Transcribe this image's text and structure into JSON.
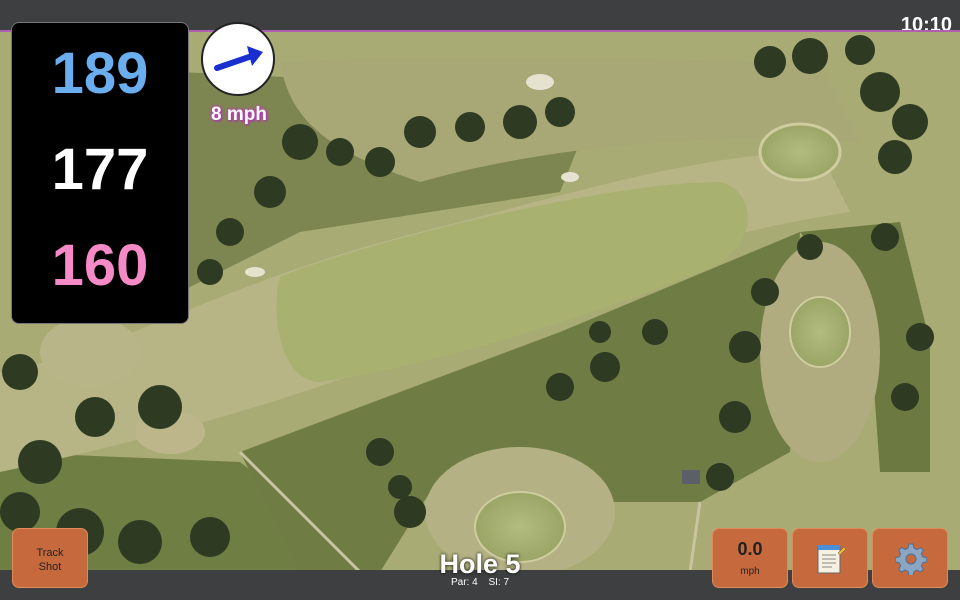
{
  "clock": "10:10",
  "distances": {
    "back": "189",
    "middle": "177",
    "front": "160"
  },
  "wind": {
    "speed": "8 mph",
    "direction": "east-northeast",
    "arrow_color": "#1a2fd0"
  },
  "hole": {
    "title": "Hole 5",
    "par": "Par: 4",
    "stroke_index": "SI: 7"
  },
  "buttons": {
    "track_shot": {
      "line1": "Track",
      "line2": "Shot"
    },
    "speed": {
      "value": "0.0",
      "unit": "mph"
    },
    "notes_icon": "notepad-icon",
    "settings_icon": "gear-icon"
  },
  "colors": {
    "back": "#6aaef0",
    "middle": "#ffffff",
    "front": "#f58ac6",
    "button": "#c66a3e",
    "bar": "#3d3f40"
  }
}
